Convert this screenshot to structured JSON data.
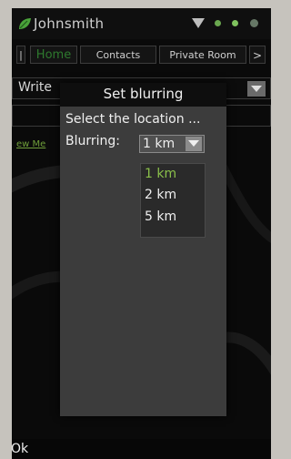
{
  "status_bar": {
    "username": "Johnsmith",
    "icons": [
      "leaf-icon",
      "signal-icon",
      "status-dot-icon",
      "status-dot-icon",
      "status-dot-icon"
    ]
  },
  "tabs": {
    "left": "|",
    "home": "Home",
    "contacts": "Contacts",
    "private_room": "Private Room",
    "more": ">"
  },
  "background": {
    "write_text": "Write",
    "new_link": "ew Me"
  },
  "dialog": {
    "title": "Set blurring",
    "message": "Select the location ...",
    "blurring_label": "Blurring:",
    "selected_value": "1 km",
    "options": [
      "1 km",
      "2 km",
      "5 km"
    ]
  },
  "softkeys": {
    "left": "Ok"
  },
  "colors": {
    "accent_green": "#8ac04a",
    "home_tab_green": "#2e7a2e",
    "dialog_bg": "#3c3c3c"
  }
}
